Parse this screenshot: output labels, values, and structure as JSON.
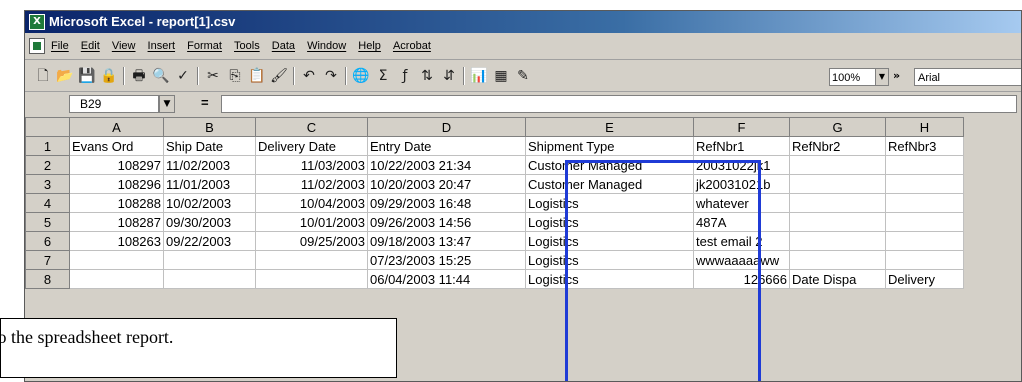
{
  "window": {
    "title": "Microsoft Excel - report[1].csv",
    "app_icon": "excel-icon"
  },
  "menu": {
    "items": [
      "File",
      "Edit",
      "View",
      "Insert",
      "Format",
      "Tools",
      "Data",
      "Window",
      "Help",
      "Acrobat"
    ]
  },
  "toolbar": {
    "zoom": "100%",
    "font": "Arial",
    "icons": [
      "new-icon",
      "open-icon",
      "save-icon",
      "permission-icon",
      "print-icon",
      "print-preview-icon",
      "spelling-icon",
      "cut-icon",
      "copy-icon",
      "paste-icon",
      "format-painter-icon",
      "undo-icon",
      "redo-icon",
      "hyperlink-icon",
      "autosum-icon",
      "function-icon",
      "sort-ascending-icon",
      "sort-descending-icon",
      "chart-wizard-icon",
      "map-icon",
      "drawing-icon"
    ]
  },
  "formula_bar": {
    "name_box": "B29",
    "equals": "=",
    "value": ""
  },
  "sheet": {
    "columns": [
      "A",
      "B",
      "C",
      "D",
      "E",
      "F",
      "G",
      "H"
    ],
    "rows": [
      {
        "num": "1",
        "cells": [
          "Evans Ord",
          "Ship Date",
          "Delivery Date",
          "Entry Date",
          "Shipment Type",
          "RefNbr1",
          "RefNbr2",
          "RefNbr3"
        ]
      },
      {
        "num": "2",
        "cells": [
          "108297",
          "11/02/2003",
          "11/03/2003",
          "10/22/2003 21:34",
          "Customer Managed",
          "20031022jk1",
          "",
          ""
        ]
      },
      {
        "num": "3",
        "cells": [
          "108296",
          "11/01/2003",
          "11/02/2003",
          "10/20/2003 20:47",
          "Customer Managed",
          "jk20031021b",
          "",
          ""
        ]
      },
      {
        "num": "4",
        "cells": [
          "108288",
          "10/02/2003",
          "10/04/2003",
          "09/29/2003 16:48",
          "Logistics",
          "whatever",
          "",
          ""
        ]
      },
      {
        "num": "5",
        "cells": [
          "108287",
          "09/30/2003",
          "10/01/2003",
          "09/26/2003 14:56",
          "Logistics",
          "487A",
          "",
          ""
        ]
      },
      {
        "num": "6",
        "cells": [
          "108263",
          "09/22/2003",
          "09/25/2003",
          "09/18/2003 13:47",
          "Logistics",
          "test email 2",
          "",
          ""
        ]
      },
      {
        "num": "7",
        "cells": [
          "",
          "",
          "",
          "07/23/2003 15:25",
          "Logistics",
          "wwwaaaaaww",
          "",
          ""
        ]
      },
      {
        "num": "8",
        "cells": [
          "",
          "",
          "",
          "06/04/2003 11:44",
          "Logistics",
          "126666",
          "Date Dispa",
          "Delivery"
        ]
      }
    ]
  },
  "caption": {
    "text": "l to the spreadsheet report."
  },
  "colors": {
    "title_gradient_start": "#0a246a",
    "highlight_box": "#1f3bd6",
    "chrome": "#d4d0c8"
  }
}
